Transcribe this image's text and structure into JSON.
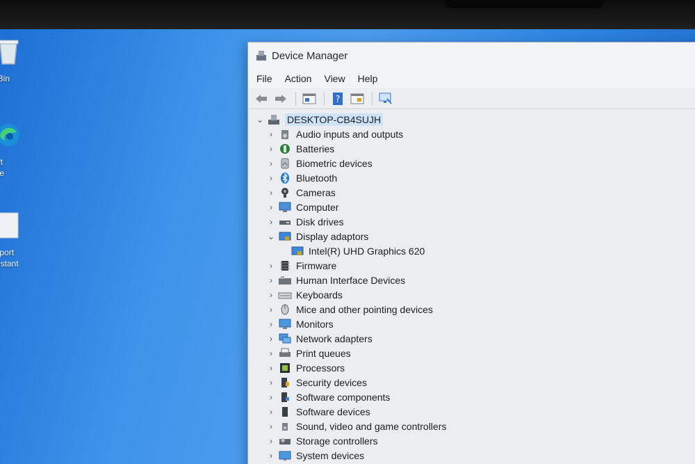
{
  "desktop": {
    "icons": [
      {
        "label": "cle Bin",
        "icon": "recycle-bin-icon"
      },
      {
        "label": "osoft\nEdge",
        "icon": "edge-icon"
      },
      {
        "label": "Support\nAssistant",
        "icon": "support-assistant-icon"
      }
    ]
  },
  "window": {
    "title": "Device Manager",
    "menu": [
      "File",
      "Action",
      "View",
      "Help"
    ],
    "toolbar": [
      "back-arrow-icon",
      "forward-arrow-icon",
      "properties-icon",
      "help-icon",
      "update-driver-icon",
      "scan-hardware-icon"
    ]
  },
  "tree": {
    "root": "DESKTOP-CB4SUJH",
    "items": [
      {
        "label": "Audio inputs and outputs",
        "icon": "speaker-icon",
        "expanded": false
      },
      {
        "label": "Batteries",
        "icon": "battery-icon",
        "expanded": false
      },
      {
        "label": "Biometric devices",
        "icon": "fingerprint-icon",
        "expanded": false
      },
      {
        "label": "Bluetooth",
        "icon": "bluetooth-icon",
        "expanded": false
      },
      {
        "label": "Cameras",
        "icon": "camera-icon",
        "expanded": false
      },
      {
        "label": "Computer",
        "icon": "computer-icon",
        "expanded": false
      },
      {
        "label": "Disk drives",
        "icon": "disk-drive-icon",
        "expanded": false
      },
      {
        "label": "Display adaptors",
        "icon": "display-adapter-icon",
        "expanded": true,
        "children": [
          "Intel(R) UHD Graphics 620"
        ]
      },
      {
        "label": "Firmware",
        "icon": "firmware-icon",
        "expanded": false
      },
      {
        "label": "Human Interface Devices",
        "icon": "hid-icon",
        "expanded": false
      },
      {
        "label": "Keyboards",
        "icon": "keyboard-icon",
        "expanded": false
      },
      {
        "label": "Mice and other pointing devices",
        "icon": "mouse-icon",
        "expanded": false
      },
      {
        "label": "Monitors",
        "icon": "monitor-icon",
        "expanded": false
      },
      {
        "label": "Network adapters",
        "icon": "network-icon",
        "expanded": false
      },
      {
        "label": "Print queues",
        "icon": "printer-icon",
        "expanded": false
      },
      {
        "label": "Processors",
        "icon": "processor-icon",
        "expanded": false
      },
      {
        "label": "Security devices",
        "icon": "security-icon",
        "expanded": false
      },
      {
        "label": "Software components",
        "icon": "software-component-icon",
        "expanded": false
      },
      {
        "label": "Software devices",
        "icon": "software-device-icon",
        "expanded": false
      },
      {
        "label": "Sound, video and game controllers",
        "icon": "sound-icon",
        "expanded": false
      },
      {
        "label": "Storage controllers",
        "icon": "storage-controller-icon",
        "expanded": false
      },
      {
        "label": "System devices",
        "icon": "system-device-icon",
        "expanded": false
      }
    ]
  }
}
